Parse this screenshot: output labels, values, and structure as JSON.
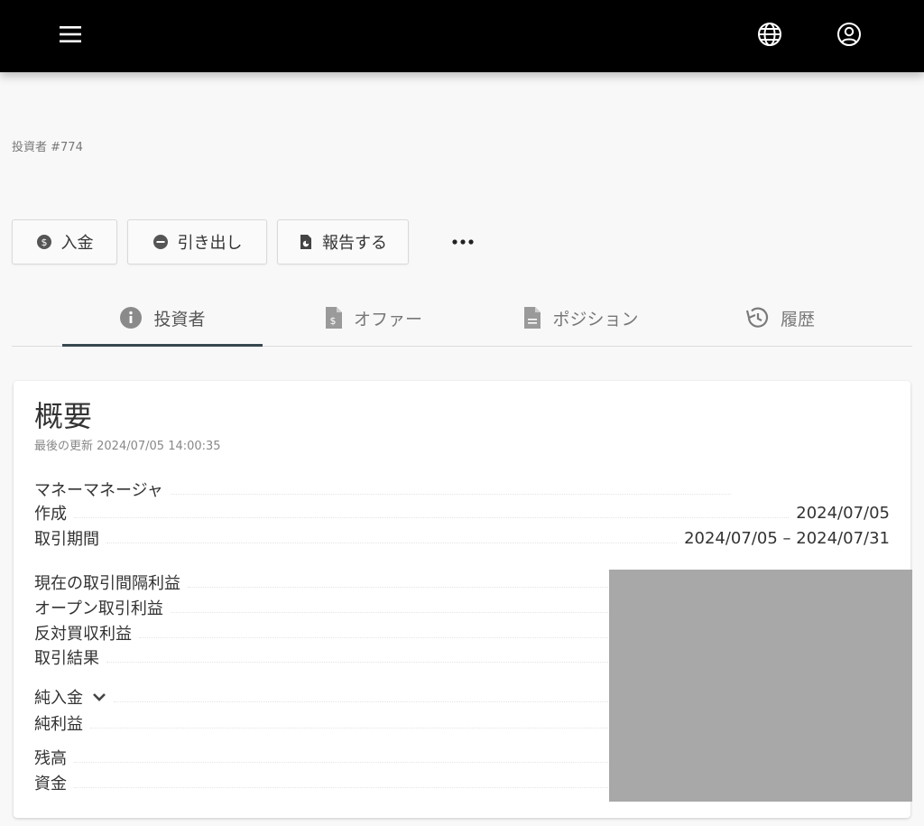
{
  "header": {
    "menu_icon": "hamburger-menu-icon",
    "globe_icon": "globe-icon",
    "user_icon": "user-account-icon"
  },
  "investor": {
    "title": "投資者 #774"
  },
  "actions": {
    "deposit_label": "入金",
    "withdraw_label": "引き出し",
    "report_label": "報告する",
    "more_icon": "more-dots-icon"
  },
  "tabs": [
    {
      "label": "投資者",
      "icon": "info-icon",
      "active": true
    },
    {
      "label": "オファー",
      "icon": "document-dollar-icon",
      "active": false
    },
    {
      "label": "ポジション",
      "icon": "document-icon",
      "active": false
    },
    {
      "label": "履歴",
      "icon": "history-icon",
      "active": false
    }
  ],
  "summary": {
    "title": "概要",
    "last_update": "最後の更新 2024/07/05 14:00:35",
    "rows": [
      {
        "label": "マネーマネージャ",
        "value": ""
      },
      {
        "label": "作成",
        "value": "2024/07/05"
      },
      {
        "label": "取引期間",
        "value": "2024/07/05 – 2024/07/31"
      },
      {
        "label": "現在の取引間隔利益",
        "value": ""
      },
      {
        "label": "オープン取引利益",
        "value": ""
      },
      {
        "label": "反対買収利益",
        "value": ""
      },
      {
        "label": "取引結果",
        "value": ""
      },
      {
        "label": "純入金",
        "value": ""
      },
      {
        "label": "純利益",
        "value": ""
      },
      {
        "label": "残高",
        "value": ""
      },
      {
        "label": "資金",
        "value": ""
      }
    ]
  },
  "colors": {
    "topbar": "#000000",
    "background": "#f8f8f8",
    "tab_indicator": "#37474f",
    "redaction": "#a8a8a8"
  }
}
